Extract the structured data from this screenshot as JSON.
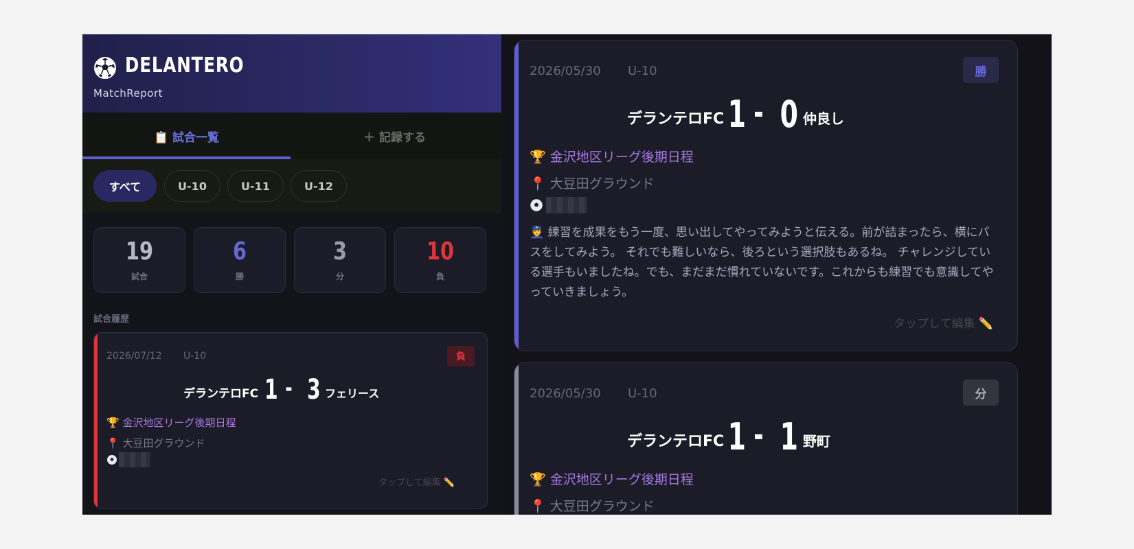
{
  "app": {
    "logo_text": "DELANTERO",
    "subtitle": "MatchReport"
  },
  "tabs": [
    {
      "icon": "clipboard-icon",
      "label": "📋 試合一覧",
      "active": true
    },
    {
      "icon": "plus-icon",
      "label": "＋ 記録する",
      "active": false
    }
  ],
  "filters": [
    {
      "label": "すべて",
      "active": true
    },
    {
      "label": "U-10",
      "active": false
    },
    {
      "label": "U-11",
      "active": false
    },
    {
      "label": "U-12",
      "active": false
    }
  ],
  "stats": [
    {
      "value": "19",
      "label": "試合",
      "color": "#b7b7c6"
    },
    {
      "value": "6",
      "label": "勝",
      "color": "#6368d4"
    },
    {
      "value": "3",
      "label": "分",
      "color": "#9b9ba8"
    },
    {
      "value": "10",
      "label": "負",
      "color": "#e0343c"
    }
  ],
  "history_label": "試合履歴",
  "left_card": {
    "date": "2026/07/12",
    "category": "U-10",
    "result": "負",
    "result_color": "#e0343c",
    "home": "デランテロFC",
    "home_score": "1",
    "away_score": "3",
    "separator": "-",
    "away": "フェリース",
    "competition": "🏆 金沢地区リーグ後期日程",
    "venue": "📍 大豆田グラウンド",
    "edit": "タップして編集 ✏️"
  },
  "right_cards": [
    {
      "date": "2026/05/30",
      "category": "U-10",
      "result": "勝",
      "result_color": "#6368d4",
      "home": "デランテロFC",
      "home_score": "1",
      "away_score": "0",
      "separator": "-",
      "away": "仲良し",
      "competition": "🏆 金沢地区リーグ後期日程",
      "venue": "📍 大豆田グラウンド",
      "note": "👮 練習を成果をもう一度、思い出してやってみようと伝える。前が詰まったら、横にパスをしてみよう。 それでも難しいなら、後ろという選択肢もあるね。 チャレンジしている選手もいましたね。でも、まだまだ慣れていないです。これからも練習でも意識してやっていきましょう。",
      "edit": "タップして編集 ✏️"
    },
    {
      "date": "2026/05/30",
      "category": "U-10",
      "result": "分",
      "result_color": "#8a8a96",
      "home": "デランテロFC",
      "home_score": "1",
      "away_score": "1",
      "separator": "-",
      "away": "野町",
      "competition": "🏆 金沢地区リーグ後期日程",
      "venue": "📍 大豆田グラウンド"
    }
  ]
}
